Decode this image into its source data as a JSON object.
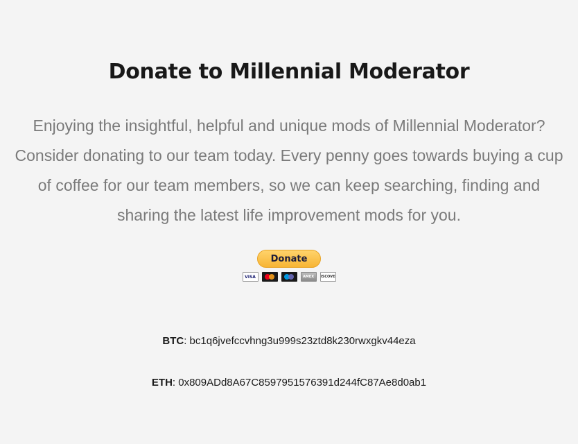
{
  "page": {
    "title": "Donate to Millennial Moderator",
    "intro": "Enjoying the insightful, helpful and unique mods of Millennial Moderator? Consider donating to our team today. Every penny goes towards buying a cup of coffee for our team members, so we can keep searching, finding and sharing the latest life improvement mods for you."
  },
  "donate": {
    "button_label": "Donate",
    "cards": [
      {
        "name": "visa",
        "label": "VISA"
      },
      {
        "name": "mastercard",
        "label": ""
      },
      {
        "name": "maestro",
        "label": ""
      },
      {
        "name": "amex",
        "label": "AMEX"
      },
      {
        "name": "discover",
        "label": "DISCOVER"
      }
    ]
  },
  "crypto": {
    "btc_label": "BTC",
    "btc_address": "bc1q6jvefccvhng3u999s23ztd8k230rwxgkv44eza",
    "eth_label": "ETH",
    "eth_address": "0x809ADd8A67C8597951576391d244fC87Ae8d0ab1"
  },
  "colors": {
    "background": "#f4f4f4",
    "button": "#ffc439"
  }
}
